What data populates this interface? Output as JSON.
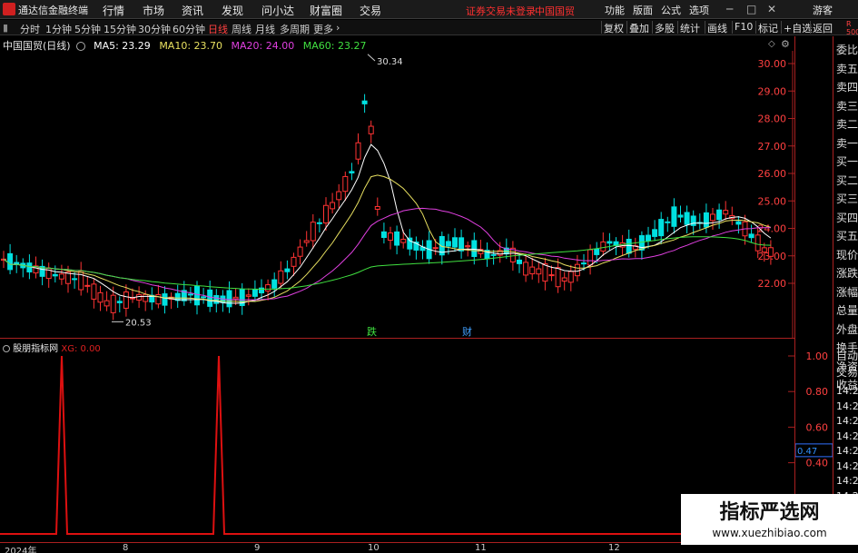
{
  "app": {
    "name": "通达信金融终端"
  },
  "menu": [
    "行情",
    "市场",
    "资讯",
    "发现",
    "问小达",
    "财富圈",
    "交易"
  ],
  "notice": {
    "login": "证券交易未登录",
    "stock": "中国国贸"
  },
  "right_menu": [
    "功能",
    "版面",
    "公式",
    "选项"
  ],
  "user": "游客",
  "periods": [
    "分时",
    "1分钟",
    "5分钟",
    "15分钟",
    "30分钟",
    "60分钟",
    "日线",
    "周线",
    "月线",
    "多周期",
    "更多"
  ],
  "active_period": "日线",
  "tools": [
    "复权",
    "叠加",
    "多股",
    "统计",
    "画线",
    "F10",
    "标记",
    "+自选",
    "返回"
  ],
  "stock_info": {
    "name": "中国国贸(日线)",
    "ma5": "MA5: 23.29",
    "ma10": "MA10: 23.70",
    "ma20": "MA20: 24.00",
    "ma60": "MA60: 23.27"
  },
  "price_axis": [
    "30.00",
    "29.00",
    "28.00",
    "27.00",
    "26.00",
    "25.00",
    "24.00",
    "23.00",
    "22.00"
  ],
  "annotations": {
    "high": "30.34",
    "low": "20.53",
    "event1": "跌",
    "event2": "财"
  },
  "indicator": {
    "name": "股朋指标网",
    "xg": "XG: 0.00",
    "axis": [
      "1.00",
      "0.80",
      "0.60",
      "0.40"
    ],
    "current": "0.47"
  },
  "dates": [
    "2024年",
    "8",
    "9",
    "10",
    "11",
    "12"
  ],
  "right_panel": [
    "委比",
    "卖五",
    "卖四",
    "卖三",
    "卖二",
    "卖一",
    "买一",
    "买二",
    "买三",
    "买四",
    "买五",
    "现价",
    "涨跌",
    "涨幅",
    "总量",
    "外盘",
    "换手",
    "净资",
    "收益",
    "自动",
    "交易"
  ],
  "times": [
    "14:2",
    "14:2",
    "14:2",
    "14:2",
    "14:2",
    "14:2",
    "14:2",
    "14:2",
    "14:2"
  ],
  "side_tag": "R 500",
  "watermark": {
    "title": "指标严选网",
    "url": "www.xuezhibiao.com"
  },
  "colors": {
    "up": "#ff3333",
    "down": "#00e0e0",
    "ma5": "#ffffff",
    "ma10": "#e8e060",
    "ma20": "#e040e0",
    "ma60": "#40e040",
    "signal": "#dd1010"
  }
}
